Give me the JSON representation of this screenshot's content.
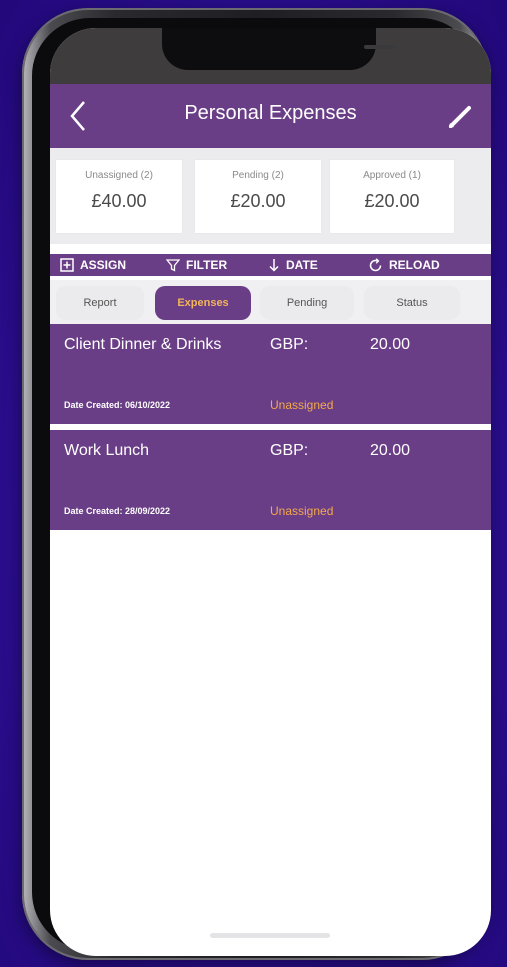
{
  "app": {
    "title": "Personal Expenses"
  },
  "summary": [
    {
      "label": "Unassigned (2)",
      "amount": "£40.00"
    },
    {
      "label": "Pending (2)",
      "amount": "£20.00"
    },
    {
      "label": "Approved (1)",
      "amount": "£20.00"
    }
  ],
  "toolbar": {
    "assign": "ASSIGN",
    "filter": "FILTER",
    "date": "DATE",
    "reload": "RELOAD"
  },
  "tabs": [
    {
      "label": "Report",
      "active": false
    },
    {
      "label": "Expenses",
      "active": true
    },
    {
      "label": "Pending",
      "active": false
    },
    {
      "label": "Status",
      "active": false
    }
  ],
  "expenses": [
    {
      "name": "Client Dinner & Drinks",
      "currency": "GBP:",
      "amount": "20.00",
      "date_created": "Date Created: 06/10/2022",
      "status": "Unassigned"
    },
    {
      "name": "Work Lunch",
      "currency": "GBP:",
      "amount": "20.00",
      "date_created": "Date Created: 28/09/2022",
      "status": "Unassigned"
    }
  ],
  "colors": {
    "brand_purple": "#6a3e86",
    "accent_orange": "#f3a94b",
    "background": "#2c0f94"
  },
  "icons": {
    "back": "chevron-left-icon",
    "edit": "pencil-icon",
    "assign": "plus-square-icon",
    "filter": "filter-icon",
    "date": "arrow-down-icon",
    "reload": "refresh-icon"
  }
}
